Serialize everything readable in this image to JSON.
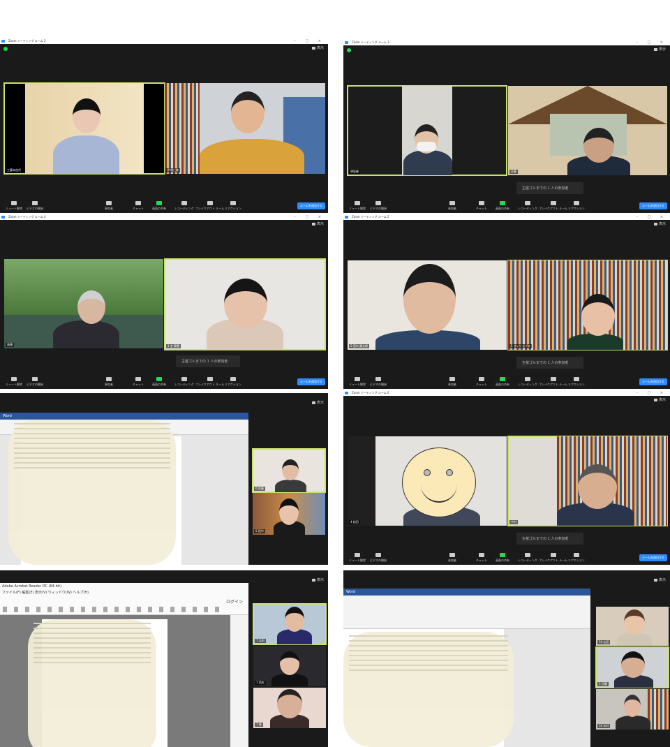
{
  "windows": [
    {
      "title": "Zoom ミーティング  ルーム 2",
      "view_label": "表示",
      "names": [
        "工藤未由代",
        "中村仁美"
      ],
      "notice": ""
    },
    {
      "title": "Zoom ミーティング  ルーム 3",
      "view_label": "表示",
      "names": [
        "明坂緑",
        "佐藤"
      ],
      "notice": "主催ゴルまでの 1 人の参加者"
    },
    {
      "title": "Zoom ミーティング  ルーム 4",
      "view_label": "表示",
      "names": [
        "高橋",
        "1 金 静穂"
      ],
      "notice": "主催ゴルまでの 1 人の参加者"
    },
    {
      "title": "Zoom ミーティング  ルーム 5",
      "view_label": "表示",
      "names": [
        "5 宮内 真太郎",
        "5 フィリップス"
      ],
      "notice": "主催ゴルまでの 1 人の参加者"
    },
    {
      "title": "",
      "view_label": "表示",
      "names": [
        "6 佐藤",
        "5 田中"
      ],
      "notice": "",
      "doc_title": "Word"
    },
    {
      "title": "Zoom ミーティング  ルーム 6",
      "view_label": "表示",
      "names": [
        "4 松田",
        "中村"
      ],
      "notice": "主催ゴルまでの 1 人の参加者"
    },
    {
      "title": "Adobe Acrobat Reader DC (64-bit)",
      "view_label": "表示",
      "names": [
        "7 吉田",
        "7 西本",
        "7 森"
      ],
      "notice": "",
      "menu": "ファイル(F)  編集(E)  表示(V)  ウィンドウ(W)  ヘルプ(H)",
      "login": "ログイン"
    },
    {
      "title": "Word",
      "view_label": "表示",
      "names": [
        "10 山田",
        "5 伊藤",
        "10 木村"
      ],
      "notice": "",
      "doc_title": "Word"
    }
  ],
  "toolbar": {
    "mute": "ミュート解除",
    "video": "ビデオの開始",
    "participants": "参加者",
    "chat": "チャット",
    "share": "画面の共有",
    "record": "レコーディング",
    "breakout": "ブレイクアウト ルーム",
    "reactions": "リアクション",
    "end": "ルームを退出する"
  },
  "colors": {
    "zoom_bg": "#1a1a1a",
    "active_speaker": "#c8e26a",
    "zoom_blue": "#2d8cff",
    "share_green": "#23d959"
  }
}
